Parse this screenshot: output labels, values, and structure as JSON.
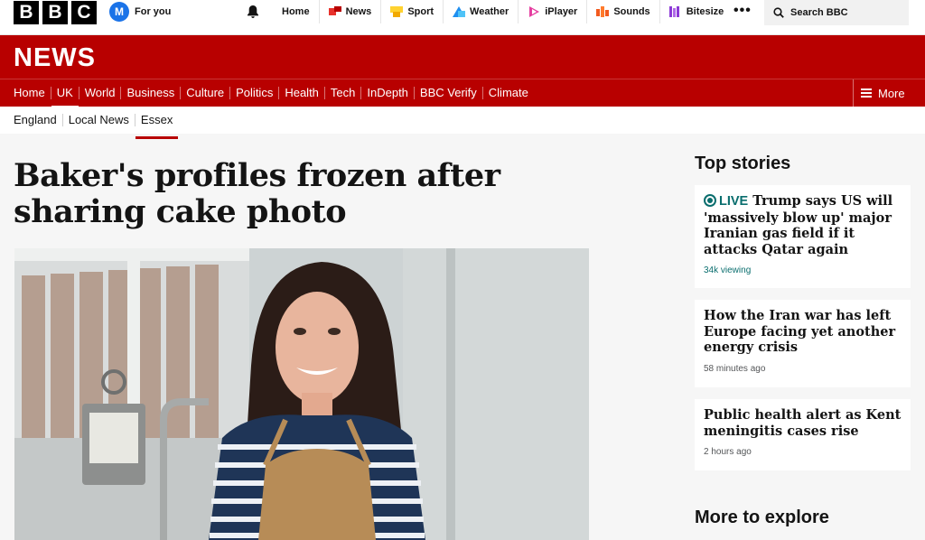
{
  "global_nav": {
    "logo_letters": [
      "B",
      "B",
      "C"
    ],
    "foryou": {
      "avatar_letter": "M",
      "label": "For you"
    },
    "items": [
      {
        "label": "Home",
        "icon": "none"
      },
      {
        "label": "News",
        "icon": "news-icon",
        "color": "#e8322c"
      },
      {
        "label": "Sport",
        "icon": "sport-icon",
        "color": "#ffd230"
      },
      {
        "label": "Weather",
        "icon": "weather-icon",
        "color": "#1f8ff0"
      },
      {
        "label": "iPlayer",
        "icon": "iplayer-icon",
        "color": "#e53ea0"
      },
      {
        "label": "Sounds",
        "icon": "sounds-icon",
        "color": "#f25a1e"
      },
      {
        "label": "Bitesize",
        "icon": "bitesize-icon",
        "color": "#8c3ad6"
      }
    ],
    "more_dots": "•••",
    "search_label": "Search BBC"
  },
  "news_header": {
    "wordmark": "NEWS",
    "brand_color": "#b80000"
  },
  "section_nav": {
    "items": [
      "Home",
      "UK",
      "World",
      "Business",
      "Culture",
      "Politics",
      "Health",
      "Tech",
      "InDepth",
      "BBC Verify",
      "Climate"
    ],
    "active": "UK",
    "more_label": "More"
  },
  "sub_nav": {
    "items": [
      "England",
      "Local News",
      "Essex"
    ],
    "active": "Essex"
  },
  "article": {
    "headline": "Baker's profiles frozen after sharing cake photo"
  },
  "sidebar": {
    "top_stories_title": "Top stories",
    "stories": [
      {
        "live_label": "LIVE",
        "title": "Trump says US will 'massively blow up' major Iranian gas field if it attacks Qatar again",
        "meta": "34k viewing"
      },
      {
        "title": "How the Iran war has left Europe facing yet another energy crisis",
        "meta": "58 minutes ago"
      },
      {
        "title": "Public health alert as Kent meningitis cases rise",
        "meta": "2 hours ago"
      }
    ],
    "more_to_explore_title": "More to explore"
  }
}
